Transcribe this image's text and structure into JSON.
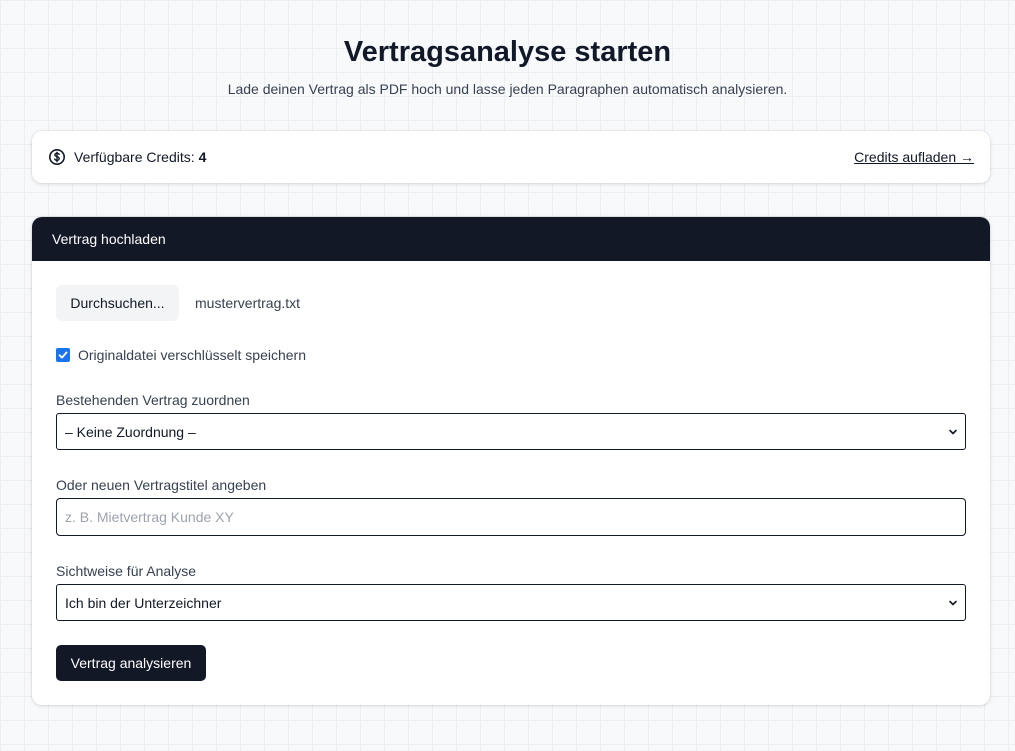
{
  "header": {
    "title": "Vertragsanalyse starten",
    "subtitle": "Lade deinen Vertrag als PDF hoch und lasse jeden Paragraphen automatisch analysieren."
  },
  "credits": {
    "label": "Verfügbare Credits:",
    "count": "4",
    "topup_link": "Credits aufladen →",
    "icon": "dollar-circle-icon"
  },
  "upload": {
    "header_title": "Vertrag hochladen",
    "browse_label": "Durchsuchen...",
    "file_name": "mustervertrag.txt",
    "encrypt_label": "Originaldatei verschlüsselt speichern",
    "encrypt_checked": true,
    "assign_label": "Bestehenden Vertrag zuordnen",
    "assign_value": "– Keine Zuordnung –",
    "title_label": "Oder neuen Vertragstitel angeben",
    "title_placeholder": "z. B. Mietvertrag Kunde XY",
    "title_value": "",
    "perspective_label": "Sichtweise für Analyse",
    "perspective_value": "Ich bin der Unterzeichner",
    "submit_label": "Vertrag analysieren"
  },
  "colors": {
    "dark": "#121826",
    "checkbox_accent": "#1a73e8",
    "background": "#f8f9fb"
  }
}
